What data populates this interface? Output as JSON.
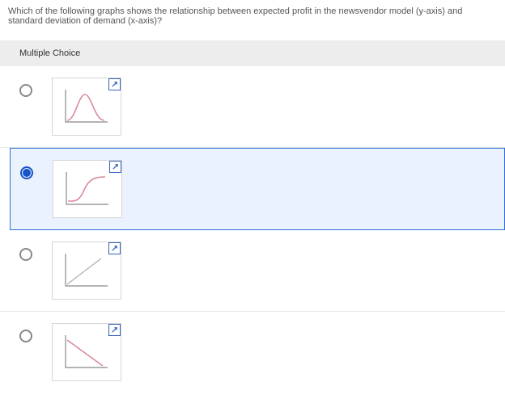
{
  "question_text": "Which of the following graphs shows the relationship between expected profit in the newsvendor model (y-axis) and standard deviation of demand (x-axis)?",
  "header": "Multiple Choice",
  "options": [
    {
      "curve": "bell",
      "selected": false
    },
    {
      "curve": "sigmoid",
      "selected": true
    },
    {
      "curve": "linear-up",
      "selected": false
    },
    {
      "curve": "linear-down",
      "selected": false
    }
  ],
  "expand_label": "expand"
}
